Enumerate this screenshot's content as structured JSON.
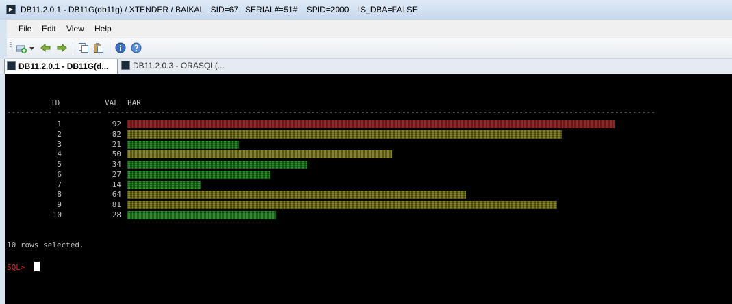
{
  "window": {
    "title": "DB11.2.0.1 - DB11G(db11g) / XTENDER / BAIKAL   SID=67   SERIAL#=51#    SPID=2000    IS_DBA=FALSE"
  },
  "menu": {
    "items": [
      "File",
      "Edit",
      "View",
      "Help"
    ]
  },
  "toolbar": {
    "icons": [
      "new-connection-icon",
      "dropdown-arrow-icon",
      "back-icon",
      "forward-icon",
      "copy-icon",
      "paste-icon",
      "info-icon",
      "help-icon"
    ]
  },
  "tabs": [
    {
      "label": "DB11.2.0.1 - DB11G(d...",
      "active": true
    },
    {
      "label": "DB11.2.0.3 - ORASQL(...",
      "active": false
    }
  ],
  "terminal": {
    "header": {
      "id": "ID",
      "val": "VAL",
      "bar": "BAR"
    },
    "rows": [
      {
        "id": "1",
        "val": "92",
        "color": "#b01c1c"
      },
      {
        "id": "2",
        "val": "82",
        "color": "#8c8a10"
      },
      {
        "id": "3",
        "val": "21",
        "color": "#1b9a1b"
      },
      {
        "id": "4",
        "val": "50",
        "color": "#8c8a10"
      },
      {
        "id": "5",
        "val": "34",
        "color": "#1b9a1b"
      },
      {
        "id": "6",
        "val": "27",
        "color": "#1b9a1b"
      },
      {
        "id": "7",
        "val": "14",
        "color": "#1b9a1b"
      },
      {
        "id": "8",
        "val": "64",
        "color": "#8c8a10"
      },
      {
        "id": "9",
        "val": "81",
        "color": "#8c8a10"
      },
      {
        "id": "10",
        "val": "28",
        "color": "#1b9a1b"
      }
    ],
    "footer": "10 rows selected.",
    "prompt": "SQL>",
    "prompt_color": "#e02020"
  }
}
